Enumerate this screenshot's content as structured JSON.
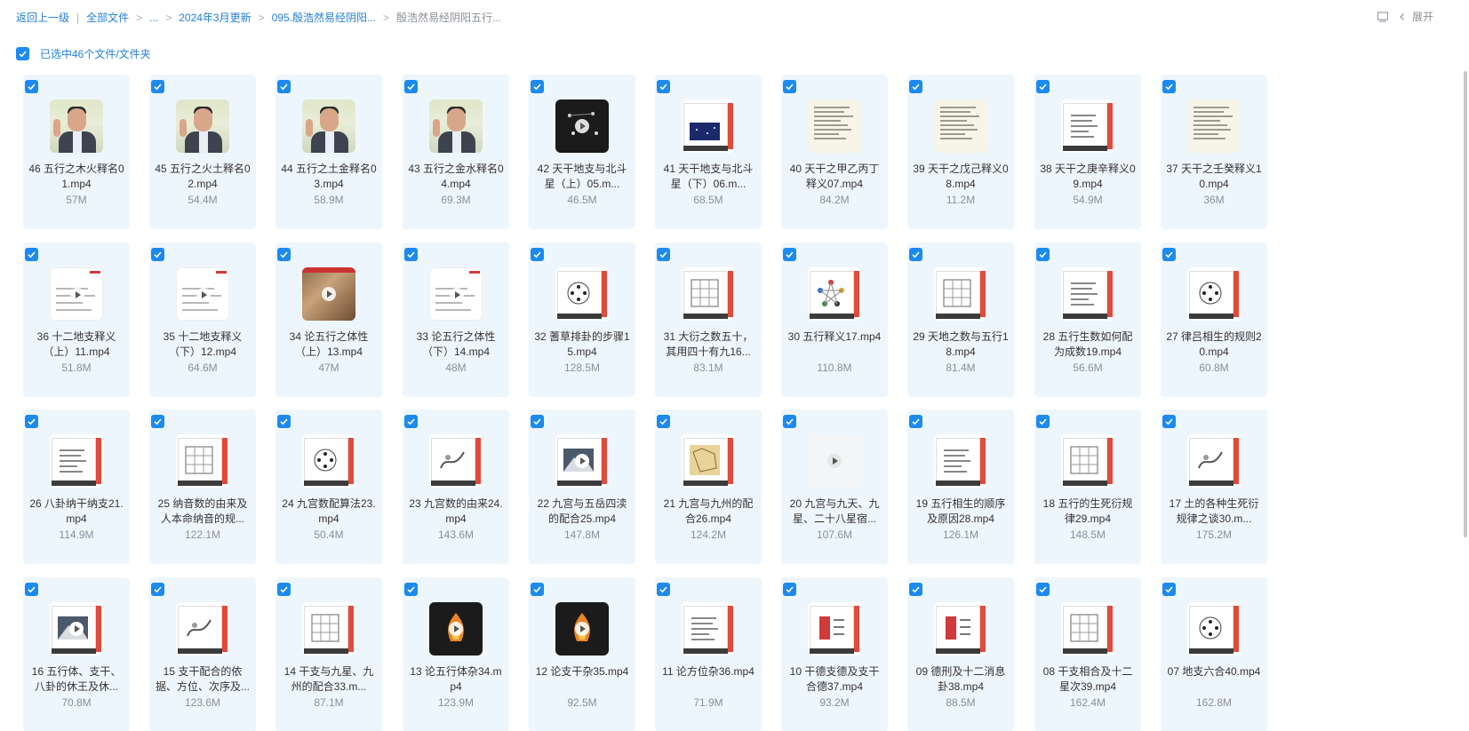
{
  "breadcrumb": {
    "back": "返回上一级",
    "all_files": "全部文件",
    "ellipsis": "...",
    "level1": "2024年3月更新",
    "level2": "095.殷浩然易经阴阳...",
    "current": "殷浩然易经阴阳五行..."
  },
  "toolbar": {
    "expand_label": "展开"
  },
  "selection": {
    "text": "已选中46个文件/文件夹"
  },
  "files": [
    {
      "name": "46 五行之木火释名01.mp4",
      "size": "57M",
      "thumb": "person"
    },
    {
      "name": "45 五行之火土释名02.mp4",
      "size": "54.4M",
      "thumb": "person"
    },
    {
      "name": "44 五行之土金释名03.mp4",
      "size": "58.9M",
      "thumb": "person"
    },
    {
      "name": "43 五行之金水释名04.mp4",
      "size": "69.3M",
      "thumb": "person"
    },
    {
      "name": "42 天干地支与北斗星（上）05.m...",
      "size": "46.5M",
      "thumb": "dark"
    },
    {
      "name": "41 天干地支与北斗星（下）06.m...",
      "size": "68.5M",
      "thumb": "slide-blue"
    },
    {
      "name": "40 天干之甲乙丙丁释义07.mp4",
      "size": "84.2M",
      "thumb": "doc"
    },
    {
      "name": "39 天干之戊己释义08.mp4",
      "size": "11.2M",
      "thumb": "doc"
    },
    {
      "name": "38 天干之庚辛释义09.mp4",
      "size": "54.9M",
      "thumb": "slide-text"
    },
    {
      "name": "37 天干之壬癸释义10.mp4",
      "size": "36M",
      "thumb": "doc"
    },
    {
      "name": "36 十二地支释义（上）11.mp4",
      "size": "51.8M",
      "thumb": "white"
    },
    {
      "name": "35 十二地支释义（下）12.mp4",
      "size": "64.6M",
      "thumb": "white"
    },
    {
      "name": "34 论五行之体性（上）13.mp4",
      "size": "47M",
      "thumb": "wood"
    },
    {
      "name": "33 论五行之体性（下）14.mp4",
      "size": "48M",
      "thumb": "white"
    },
    {
      "name": "32 蓍草排卦的步骤15.mp4",
      "size": "128.5M",
      "thumb": "slide-circle"
    },
    {
      "name": "31 大衍之数五十，其用四十有九16...",
      "size": "83.1M",
      "thumb": "slide-grid"
    },
    {
      "name": "30 五行释义17.mp4",
      "size": "110.8M",
      "thumb": "slide-star"
    },
    {
      "name": "29 天地之数与五行18.mp4",
      "size": "81.4M",
      "thumb": "slide-grid"
    },
    {
      "name": "28 五行生数如何配为成数19.mp4",
      "size": "56.6M",
      "thumb": "slide-text"
    },
    {
      "name": "27 律吕相生的规则20.mp4",
      "size": "60.8M",
      "thumb": "slide-circle"
    },
    {
      "name": "26 八卦纳干纳支21.mp4",
      "size": "114.9M",
      "thumb": "slide-text"
    },
    {
      "name": "25 纳音数的由来及人本命纳音的规...",
      "size": "122.1M",
      "thumb": "slide-grid"
    },
    {
      "name": "24 九宫数配算法23.mp4",
      "size": "50.4M",
      "thumb": "slide-circle"
    },
    {
      "name": "23 九宫数的由来24.mp4",
      "size": "143.6M",
      "thumb": "slide-ink"
    },
    {
      "name": "22 九宫与五岳四渎的配合25.mp4",
      "size": "147.8M",
      "thumb": "slide-photo"
    },
    {
      "name": "21 九宫与九州的配合26.mp4",
      "size": "124.2M",
      "thumb": "slide-map"
    },
    {
      "name": "20 九宫与九天、九星、二十八星宿...",
      "size": "107.6M",
      "thumb": "blank"
    },
    {
      "name": "19 五行相生的顺序及原因28.mp4",
      "size": "126.1M",
      "thumb": "slide-text"
    },
    {
      "name": "18 五行的生死衍规律29.mp4",
      "size": "148.5M",
      "thumb": "slide-grid"
    },
    {
      "name": "17 土的各种生死衍规律之谈30.m...",
      "size": "175.2M",
      "thumb": "slide-ink"
    },
    {
      "name": "16 五行体、支干、八卦的休王及休...",
      "size": "70.8M",
      "thumb": "slide-photo"
    },
    {
      "name": "15 支干配合的依据、方位、次序及...",
      "size": "123.6M",
      "thumb": "slide-ink"
    },
    {
      "name": "14 干支与九星、九州的配合33.m...",
      "size": "87.1M",
      "thumb": "slide-grid"
    },
    {
      "name": "13 论五行体杂34.mp4",
      "size": "123.9M",
      "thumb": "dark-fire"
    },
    {
      "name": "12 论支干杂35.mp4",
      "size": "92.5M",
      "thumb": "dark-fire"
    },
    {
      "name": "11 论方位杂36.mp4",
      "size": "71.9M",
      "thumb": "slide-text"
    },
    {
      "name": "10 干德支德及支干合德37.mp4",
      "size": "93.2M",
      "thumb": "slide-red"
    },
    {
      "name": "09 德刑及十二消息卦38.mp4",
      "size": "88.5M",
      "thumb": "slide-red"
    },
    {
      "name": "08 干支相合及十二星次39.mp4",
      "size": "162.4M",
      "thumb": "slide-grid"
    },
    {
      "name": "07 地支六合40.mp4",
      "size": "162.8M",
      "thumb": "slide-circle"
    }
  ]
}
